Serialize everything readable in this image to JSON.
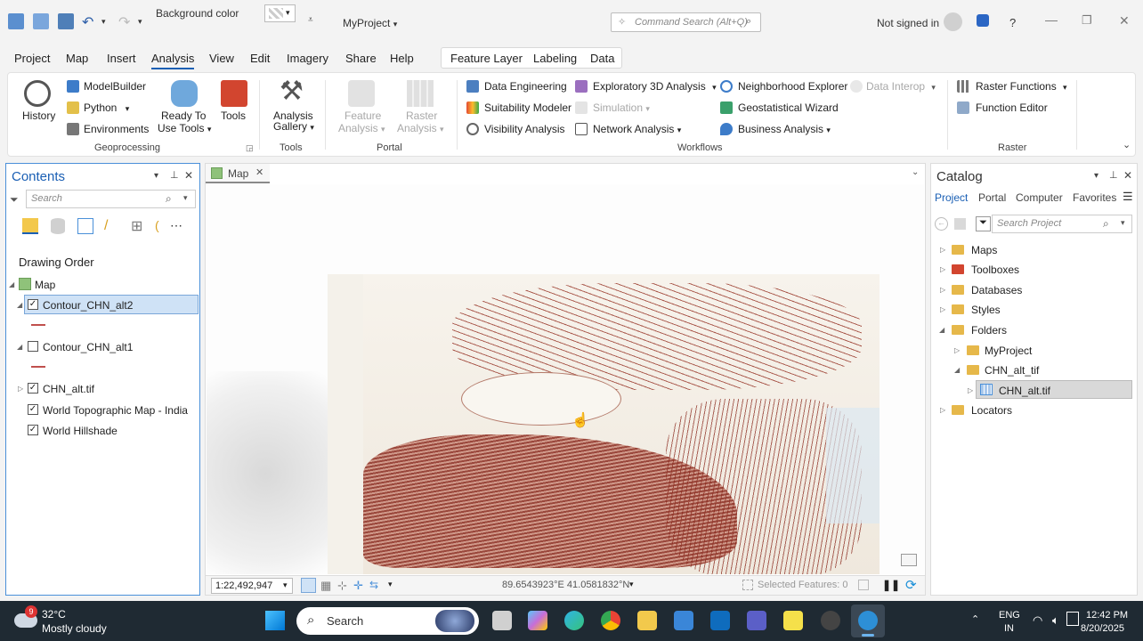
{
  "titlebar": {
    "background_color_label": "Background color",
    "project_menu": "MyProject",
    "command_search_placeholder": "Command Search (Alt+Q)",
    "signin_label": "Not signed in"
  },
  "tabs": {
    "items": [
      "Project",
      "Map",
      "Insert",
      "Analysis",
      "View",
      "Edit",
      "Imagery",
      "Share",
      "Help"
    ],
    "active": "Analysis",
    "contextual": [
      "Feature Layer",
      "Labeling",
      "Data"
    ]
  },
  "ribbon": {
    "geoprocessing": {
      "history": "History",
      "modelbuilder": "ModelBuilder",
      "python": "Python",
      "environments": "Environments",
      "ready_line1": "Ready To",
      "ready_line2": "Use Tools",
      "tools": "Tools",
      "label": "Geoprocessing"
    },
    "tools_group": {
      "line1": "Analysis",
      "line2": "Gallery",
      "label": "Tools"
    },
    "portal": {
      "feature_line1": "Feature",
      "feature_line2": "Analysis",
      "raster_line1": "Raster",
      "raster_line2": "Analysis",
      "label": "Portal"
    },
    "workflows": {
      "data_engineering": "Data Engineering",
      "suitability": "Suitability Modeler",
      "visibility": "Visibility Analysis",
      "exploratory": "Exploratory 3D Analysis",
      "simulation": "Simulation",
      "network": "Network Analysis",
      "neighborhood": "Neighborhood Explorer",
      "data_interop": "Data Interop",
      "geostatistical": "Geostatistical Wizard",
      "business": "Business Analysis",
      "label": "Workflows"
    },
    "raster": {
      "functions": "Raster Functions",
      "editor": "Function Editor",
      "label": "Raster"
    }
  },
  "contents": {
    "title": "Contents",
    "search_placeholder": "Search",
    "drawing_order": "Drawing Order",
    "layers": [
      {
        "name": "Map"
      },
      {
        "name": "Contour_CHN_alt2",
        "checked": true
      },
      {
        "name": "Contour_CHN_alt1",
        "checked": false
      },
      {
        "name": "CHN_alt.tif",
        "checked": true
      },
      {
        "name": "World Topographic Map - India",
        "checked": true
      },
      {
        "name": "World Hillshade",
        "checked": true
      }
    ],
    "check_mark": "✓"
  },
  "map": {
    "tab_label": "Map",
    "scale": "1:22,492,947",
    "coordinates": "89.6543923°E 41.0581832°N",
    "selected_features": "Selected Features: 0"
  },
  "catalog": {
    "title": "Catalog",
    "tabs": [
      "Project",
      "Portal",
      "Computer",
      "Favorites"
    ],
    "search_placeholder": "Search Project",
    "items": [
      "Maps",
      "Toolboxes",
      "Databases",
      "Styles",
      "Folders",
      "MyProject",
      "CHN_alt_tif",
      "CHN_alt.tif",
      "Locators"
    ]
  },
  "taskbar": {
    "weather_badge": "9",
    "temperature": "32°C",
    "weather": "Mostly cloudy",
    "search_label": "Search",
    "lang1": "ENG",
    "lang2": "IN",
    "time": "12:42 PM",
    "date": "8/20/2025"
  },
  "colors": {
    "accent": "#1a5fb4",
    "contour": "#8b2a1e",
    "taskbar": "#1f2a33"
  }
}
